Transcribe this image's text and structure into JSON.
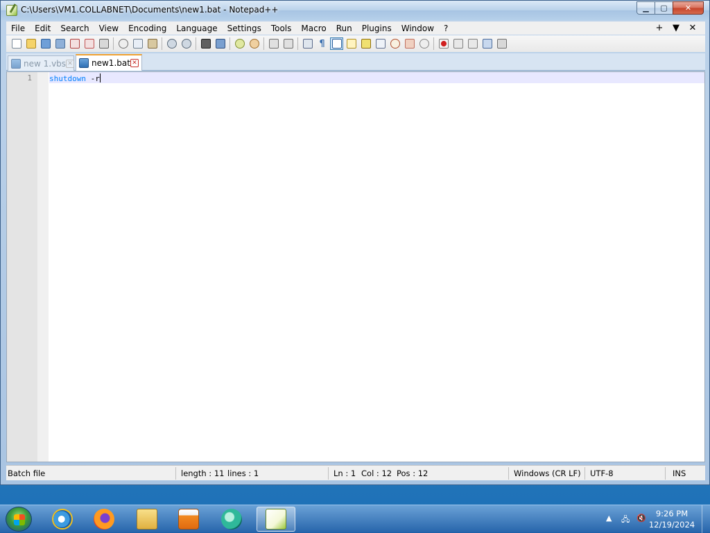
{
  "window": {
    "title": "C:\\Users\\VM1.COLLABNET\\Documents\\new1.bat - Notepad++",
    "controls": [
      "minimize",
      "maximize",
      "close"
    ]
  },
  "menubar": {
    "items": [
      "File",
      "Edit",
      "Search",
      "View",
      "Encoding",
      "Language",
      "Settings",
      "Tools",
      "Macro",
      "Run",
      "Plugins",
      "Window",
      "?"
    ],
    "right": [
      "+",
      "▼",
      "✕"
    ]
  },
  "toolbar": {
    "icons": [
      "new-file-icon",
      "open-file-icon",
      "save-icon",
      "save-all-icon",
      "close-icon",
      "close-all-icon",
      "print-icon",
      "cut-icon",
      "copy-icon",
      "paste-icon",
      "undo-icon",
      "redo-icon",
      "find-icon",
      "replace-icon",
      "zoom-in-icon",
      "zoom-out-icon",
      "sync-vertical-icon",
      "sync-horizontal-icon",
      "word-wrap-icon",
      "show-all-chars-icon",
      "indent-guide-icon",
      "user-language-icon",
      "doc-map-icon",
      "function-list-icon",
      "folder-workspace-icon",
      "monitoring-icon",
      "record-macro-icon",
      "stop-macro-icon",
      "play-macro-icon",
      "run-macro-multiple-icon",
      "save-macro-icon"
    ]
  },
  "tabs": [
    {
      "label": "new 1.vbs",
      "active": false
    },
    {
      "label": "new1.bat",
      "active": true
    }
  ],
  "editor": {
    "line_number": "1",
    "keyword": "shutdown",
    "arg": " -r"
  },
  "statusbar": {
    "file_type": "Batch file",
    "length": "length : 11",
    "lines": "lines : 1",
    "ln": "Ln : 1",
    "col": "Col : 12",
    "pos": "Pos : 12",
    "eol": "Windows (CR LF)",
    "encoding": "UTF-8",
    "mode": "INS"
  },
  "taskbar": {
    "apps": [
      "internet-explorer-icon",
      "firefox-icon",
      "file-explorer-icon",
      "media-player-icon",
      "app-icon",
      "notepadpp-icon"
    ],
    "time": "9:26 PM",
    "date": "12/19/2024"
  },
  "colors": {
    "keyword": "#0080ff",
    "current_line": "#e8e8ff",
    "accent_tab": "#f0a030"
  }
}
